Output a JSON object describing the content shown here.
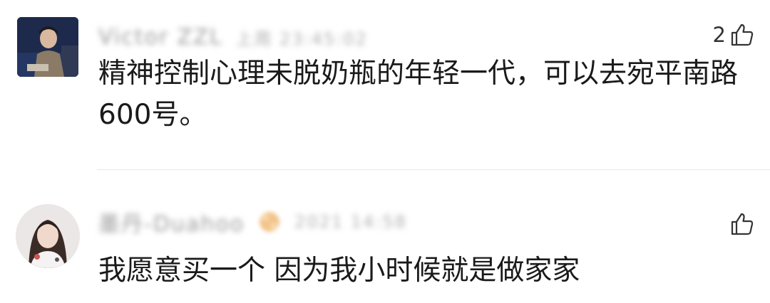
{
  "comments": [
    {
      "username": "Victor ZZL",
      "time": "上周 23:45:02",
      "likes": "2",
      "text": "精神控制心理未脱奶瓶的年轻一代，可以去宛平南路600号。",
      "avatar": "photo of man in suit"
    },
    {
      "username": "墨丹-Duahoo",
      "time": "2021 14:58",
      "likes": "",
      "text": "我愿意买一个 因为我小时候就是做家家",
      "avatar": "photo of girl"
    }
  ],
  "icons": {
    "like": "thumbs-up-icon"
  },
  "colors": {
    "meta_text": "#9b9b9b",
    "body_text": "#1a1a1a",
    "divider": "#e8e8e8"
  }
}
